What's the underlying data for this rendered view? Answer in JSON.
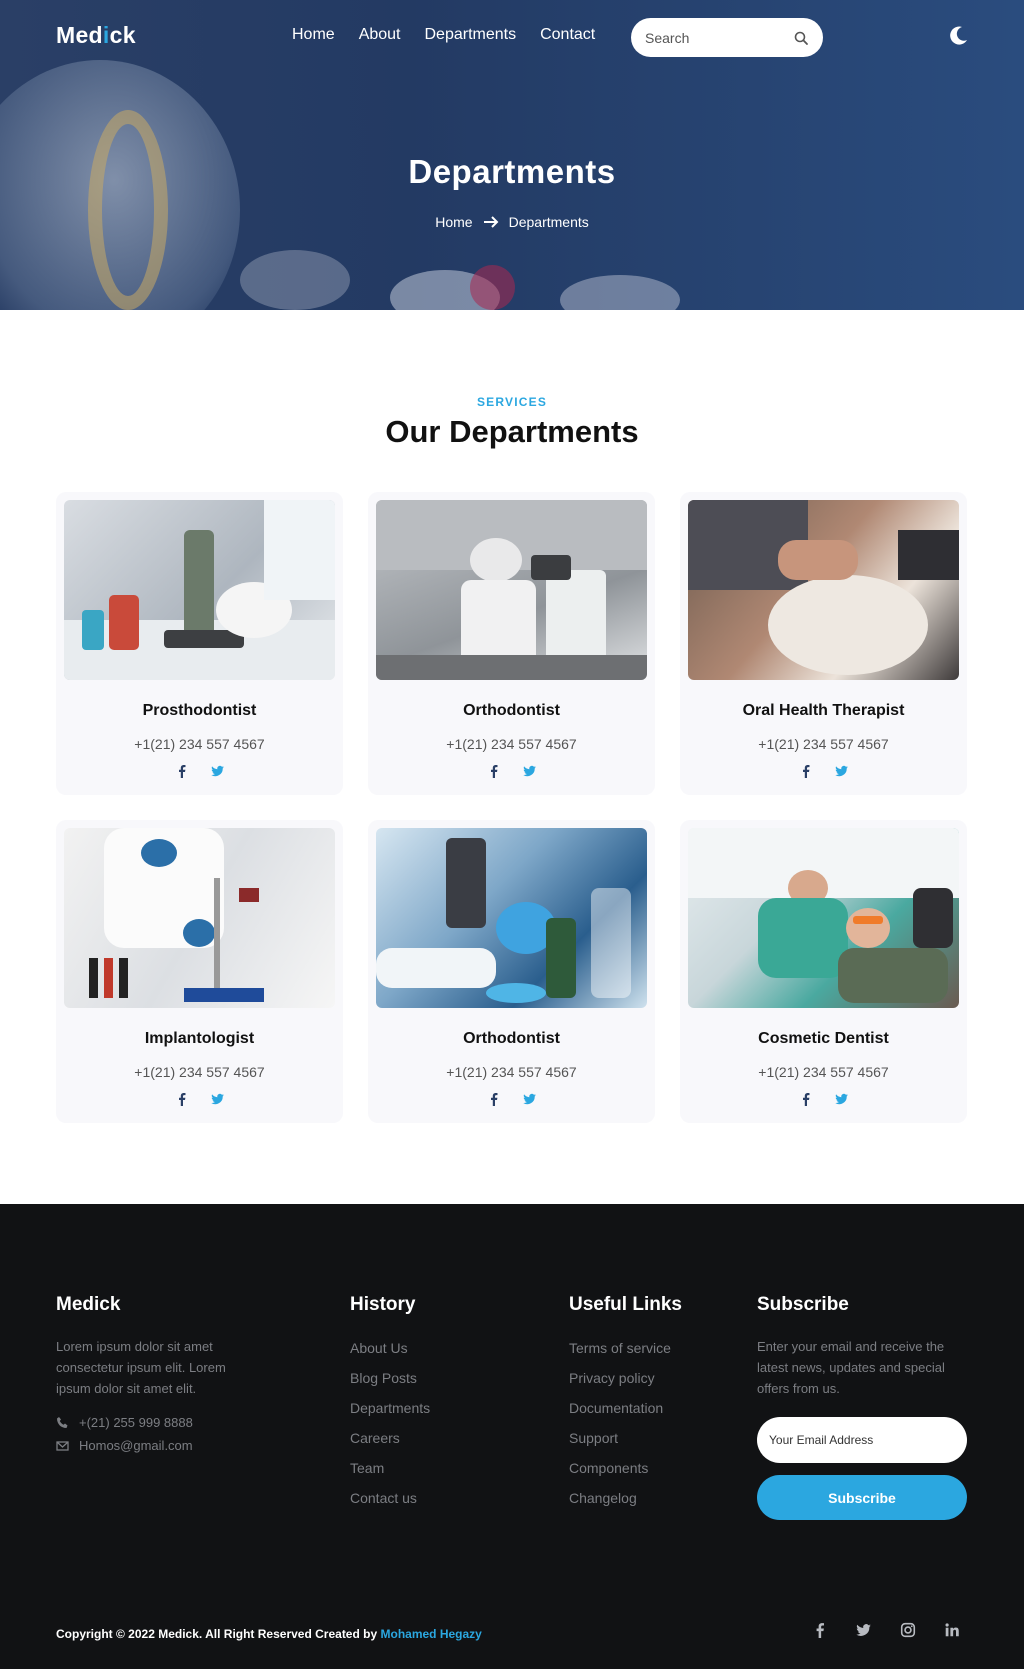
{
  "header": {
    "logo_start": "Med",
    "logo_accent": "i",
    "logo_end": "ck",
    "nav": [
      "Home",
      "About",
      "Departments",
      "Contact"
    ],
    "search_placeholder": "Search"
  },
  "hero": {
    "title": "Departments",
    "breadcrumb_home": "Home",
    "breadcrumb_current": "Departments"
  },
  "services": {
    "kicker": "SERVICES",
    "title": "Our Departments",
    "cards": [
      {
        "name": "Prosthodontist",
        "phone": "+1(21) 234 557 4567"
      },
      {
        "name": "Orthodontist",
        "phone": "+1(21) 234 557 4567"
      },
      {
        "name": "Oral Health Therapist",
        "phone": "+1(21) 234 557 4567"
      },
      {
        "name": "Implantologist",
        "phone": "+1(21) 234 557 4567"
      },
      {
        "name": "Orthodontist",
        "phone": "+1(21) 234 557 4567"
      },
      {
        "name": "Cosmetic Dentist",
        "phone": "+1(21) 234 557 4567"
      }
    ]
  },
  "footer": {
    "brand": {
      "title": "Medick",
      "text": "Lorem ipsum dolor sit amet consectetur ipsum elit. Lorem ipsum dolor sit amet elit.",
      "phone": "+(21) 255 999 8888",
      "email": "Homos@gmail.com"
    },
    "history": {
      "title": "History",
      "links": [
        "About Us",
        "Blog Posts",
        "Departments",
        "Careers",
        "Team",
        "Contact us"
      ]
    },
    "useful": {
      "title": "Useful Links",
      "links": [
        "Terms of service",
        "Privacy policy",
        "Documentation",
        "Support",
        "Components",
        "Changelog"
      ]
    },
    "subscribe": {
      "title": "Subscribe",
      "text": "Enter your email and receive the latest news, updates and special offers from us.",
      "placeholder": "Your Email Address",
      "button": "Subscribe"
    },
    "copyright_text": "Copyright © 2022 Medick. All Right Reserved Created by ",
    "copyright_author": "Mohamed Hegazy"
  },
  "colors": {
    "accent": "#2ba7e0",
    "footer_bg": "#111214",
    "hero_bg": "#233a63"
  }
}
